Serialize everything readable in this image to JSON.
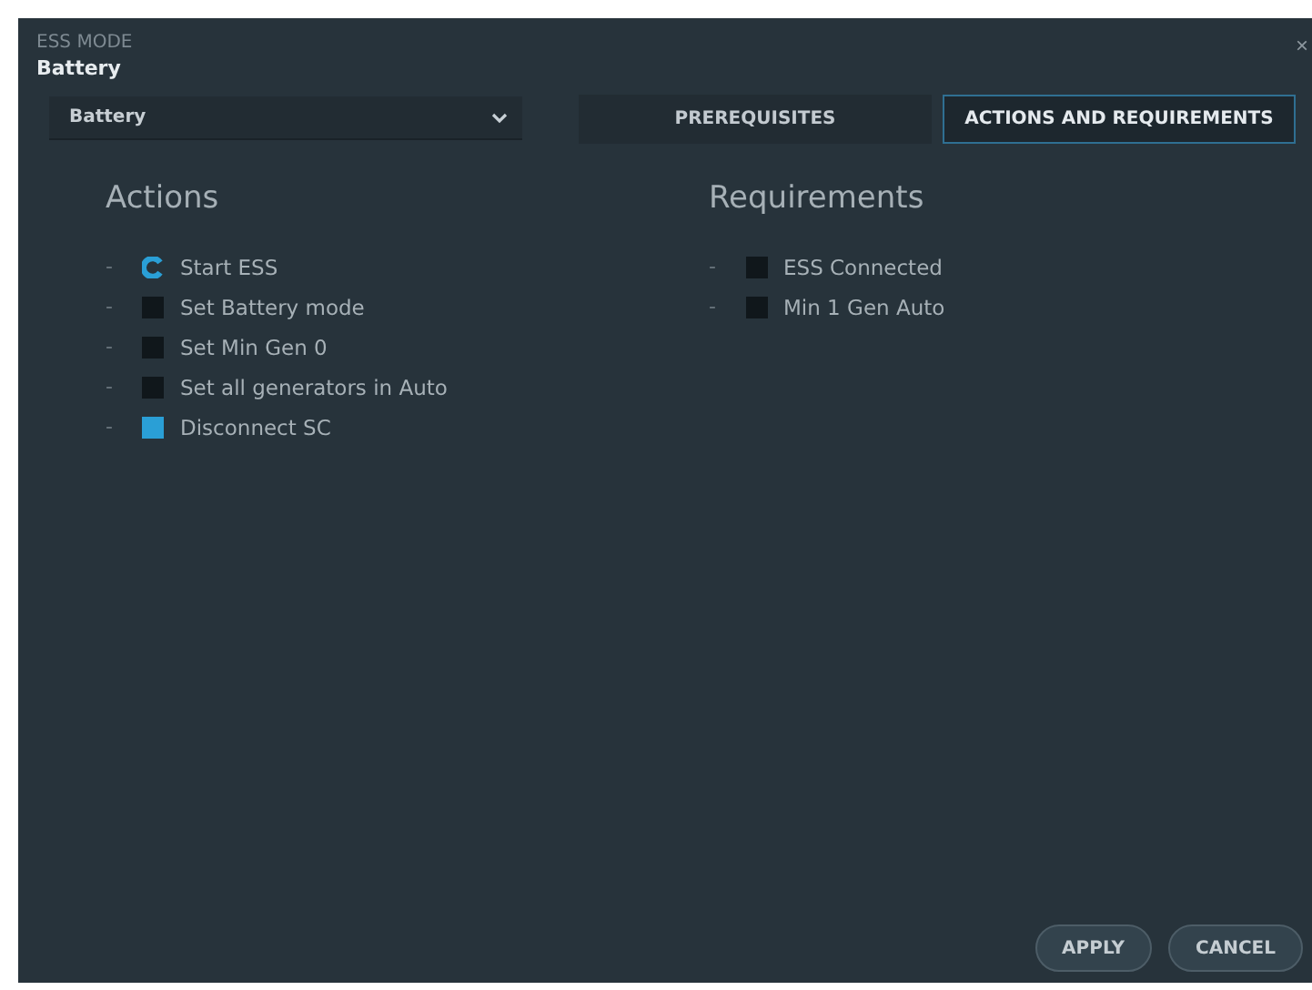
{
  "dialog": {
    "caption": "ESS MODE",
    "title": "Battery",
    "close": "×"
  },
  "mode_select": {
    "value": "Battery"
  },
  "tabs": [
    {
      "label": "PREREQUISITES",
      "selected": false
    },
    {
      "label": "ACTIONS AND REQUIREMENTS",
      "selected": true
    }
  ],
  "actions": {
    "heading": "Actions",
    "items": [
      {
        "marker": "-",
        "label": "Start ESS",
        "kind": "running"
      },
      {
        "marker": "-",
        "label": "Set Battery mode",
        "kind": "pending"
      },
      {
        "marker": "-",
        "label": "Set Min Gen 0",
        "kind": "pending"
      },
      {
        "marker": "-",
        "label": "Set all generators in Auto",
        "kind": "pending"
      },
      {
        "marker": "-",
        "label": "Disconnect SC",
        "kind": "done"
      }
    ]
  },
  "requirements": {
    "heading": "Requirements",
    "items": [
      {
        "marker": "-",
        "label": "ESS Connected",
        "kind": "pending"
      },
      {
        "marker": "-",
        "label": "Min 1 Gen Auto",
        "kind": "pending"
      }
    ]
  },
  "buttons": [
    "APPLY",
    "CANCEL"
  ]
}
